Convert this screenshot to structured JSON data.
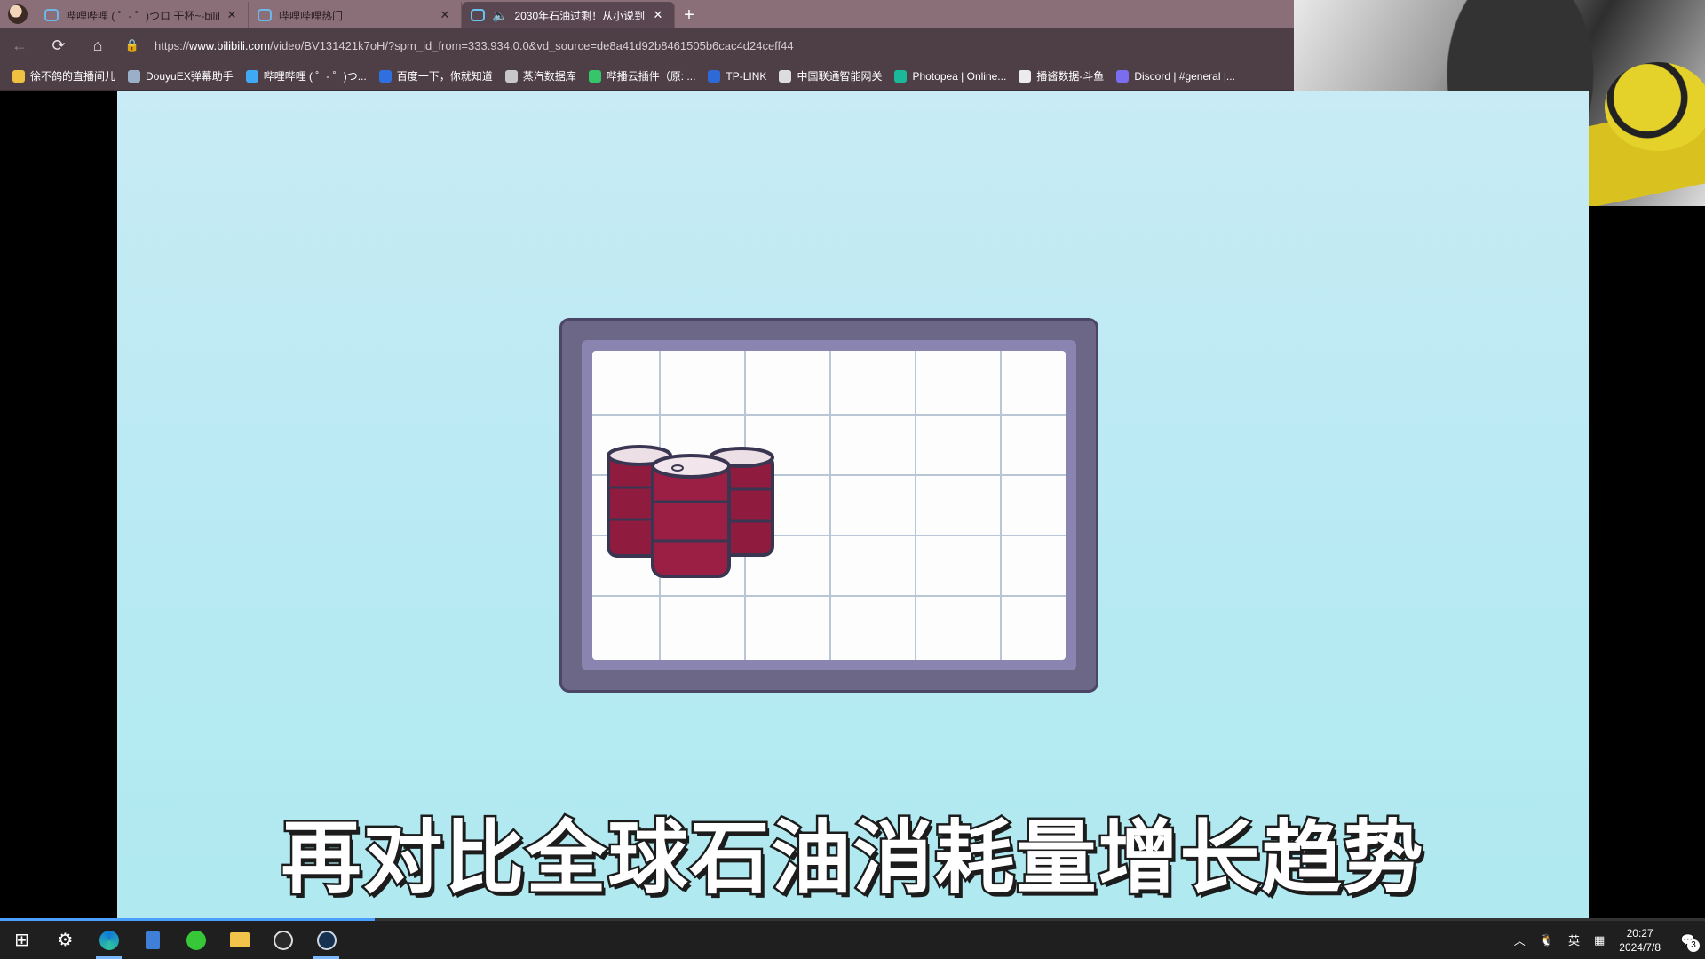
{
  "tabs": [
    {
      "label": "哔哩哔哩 ( ゜- ゜)つロ 干杯~-bilib",
      "active": false
    },
    {
      "label": "哔哩哔哩热门",
      "active": false
    },
    {
      "label": "2030年石油过剩！从小说到",
      "active": true
    }
  ],
  "address": {
    "prefix": "https://",
    "host": "www.bilibili.com",
    "path": "/video/BV131421k7oH/?spm_id_from=333.934.0.0&vd_source=de8a41d92b8461505b6cac4d24ceff44"
  },
  "bookmarks": [
    {
      "label": "徐不鸽的直播间儿",
      "icon_color": "#f0c040"
    },
    {
      "label": "DouyuEX弹幕助手",
      "icon_color": "#9ab0c8"
    },
    {
      "label": "哔哩哔哩 ( ゜- ゜)つ...",
      "icon_color": "#3fa9f5"
    },
    {
      "label": "百度一下，你就知道",
      "icon_color": "#2f6fe0"
    },
    {
      "label": "蒸汽数据库",
      "icon_color": "#c8c8c8"
    },
    {
      "label": "哔播云插件（原: ...",
      "icon_color": "#35c66b"
    },
    {
      "label": "TP-LINK",
      "icon_color": "#2d6ad8"
    },
    {
      "label": "中国联通智能网关",
      "icon_color": "#dddddd"
    },
    {
      "label": "Photopea | Online...",
      "icon_color": "#1ab99a"
    },
    {
      "label": "播酱数据-斗鱼",
      "icon_color": "#ececec"
    },
    {
      "label": "Discord | #general |...",
      "icon_color": "#7a6df0"
    }
  ],
  "video": {
    "subtitle": "再对比全球石油消耗量增长趋势",
    "progress": 0.22
  },
  "taskbar": {
    "icons": [
      "windows-start-icon",
      "settings-icon",
      "edge-icon",
      "calculator-icon",
      "green-app-icon",
      "folder-icon",
      "obs-icon",
      "steam-icon"
    ],
    "ime": "英",
    "time": "20:27",
    "date": "2024/7/8",
    "notifications": "3"
  }
}
